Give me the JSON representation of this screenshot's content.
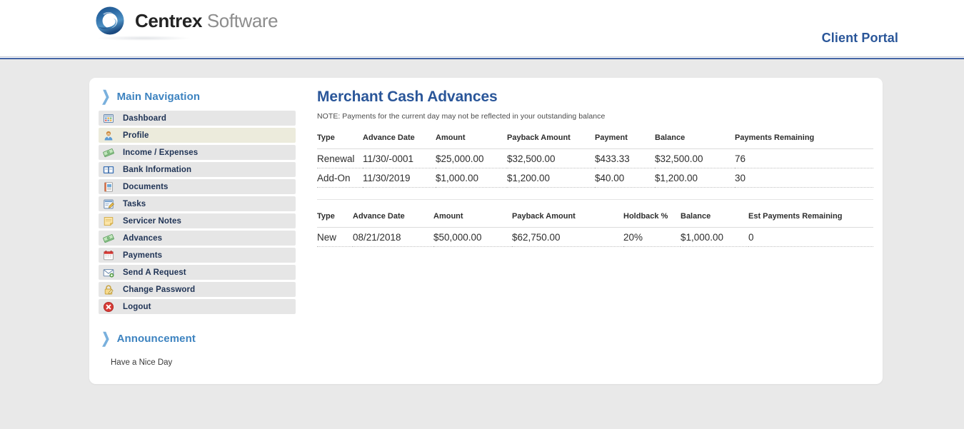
{
  "header": {
    "logo_brand_bold": "Centrex",
    "logo_brand_light": "Software",
    "logo_icon": "centrex-circular-swirl-logo",
    "portal_label": "Client Portal"
  },
  "sidebar": {
    "nav_section": {
      "chevron_icon": "chevron-right-icon",
      "title": "Main Navigation",
      "items": [
        {
          "label": "Dashboard",
          "icon": "dashboard-grid-icon",
          "name": "dashboard",
          "active": false
        },
        {
          "label": "Profile",
          "icon": "user-profile-icon",
          "name": "profile",
          "active": true
        },
        {
          "label": "Income / Expenses",
          "icon": "money-bills-icon",
          "name": "income-expenses",
          "active": false
        },
        {
          "label": "Bank Information",
          "icon": "open-book-icon",
          "name": "bank-information",
          "active": false
        },
        {
          "label": "Documents",
          "icon": "document-icon",
          "name": "documents",
          "active": false
        },
        {
          "label": "Tasks",
          "icon": "task-edit-icon",
          "name": "tasks",
          "active": false
        },
        {
          "label": "Servicer Notes",
          "icon": "sticky-note-icon",
          "name": "servicer-notes",
          "active": false
        },
        {
          "label": "Advances",
          "icon": "money-bills-icon",
          "name": "advances",
          "active": false
        },
        {
          "label": "Payments",
          "icon": "calendar-icon",
          "name": "payments",
          "active": false
        },
        {
          "label": "Send A Request",
          "icon": "envelope-icon",
          "name": "send-a-request",
          "active": false
        },
        {
          "label": "Change Password",
          "icon": "padlock-edit-icon",
          "name": "change-password",
          "active": false
        },
        {
          "label": "Logout",
          "icon": "logout-close-icon",
          "name": "logout",
          "active": false
        }
      ]
    },
    "announcement_section": {
      "chevron_icon": "chevron-right-icon",
      "title": "Announcement",
      "text": "Have a Nice Day"
    }
  },
  "main": {
    "title": "Merchant Cash Advances",
    "note": "NOTE: Payments for the current day may not be reflected in your outstanding balance",
    "tables": [
      {
        "name": "merchant-cash-advances-table",
        "columns": [
          "Type",
          "Advance Date",
          "Amount",
          "Payback Amount",
          "Payment",
          "Balance",
          "Payments Remaining"
        ],
        "rows": [
          [
            "Renewal",
            "11/30/-0001",
            "$25,000.00",
            "$32,500.00",
            "$433.33",
            "$32,500.00",
            "76"
          ],
          [
            "Add-On",
            "11/30/2019",
            "$1,000.00",
            "$1,200.00",
            "$40.00",
            "$1,200.00",
            "30"
          ]
        ]
      },
      {
        "name": "holdback-advances-table",
        "columns": [
          "Type",
          "Advance Date",
          "Amount",
          "Payback Amount",
          "Holdback %",
          "Balance",
          "Est Payments Remaining"
        ],
        "rows": [
          [
            "New",
            "08/21/2018",
            "$50,000.00",
            "$62,750.00",
            "20%",
            "$1,000.00",
            "0"
          ]
        ]
      }
    ]
  },
  "colors": {
    "brand_blue": "#2a5699",
    "rule_blue": "#2d4f93",
    "section_heading_blue": "#3d83c0",
    "page_background": "#e9e9e9",
    "nav_item_background": "#e6e6e6",
    "nav_item_active_background": "#ecebdc"
  }
}
